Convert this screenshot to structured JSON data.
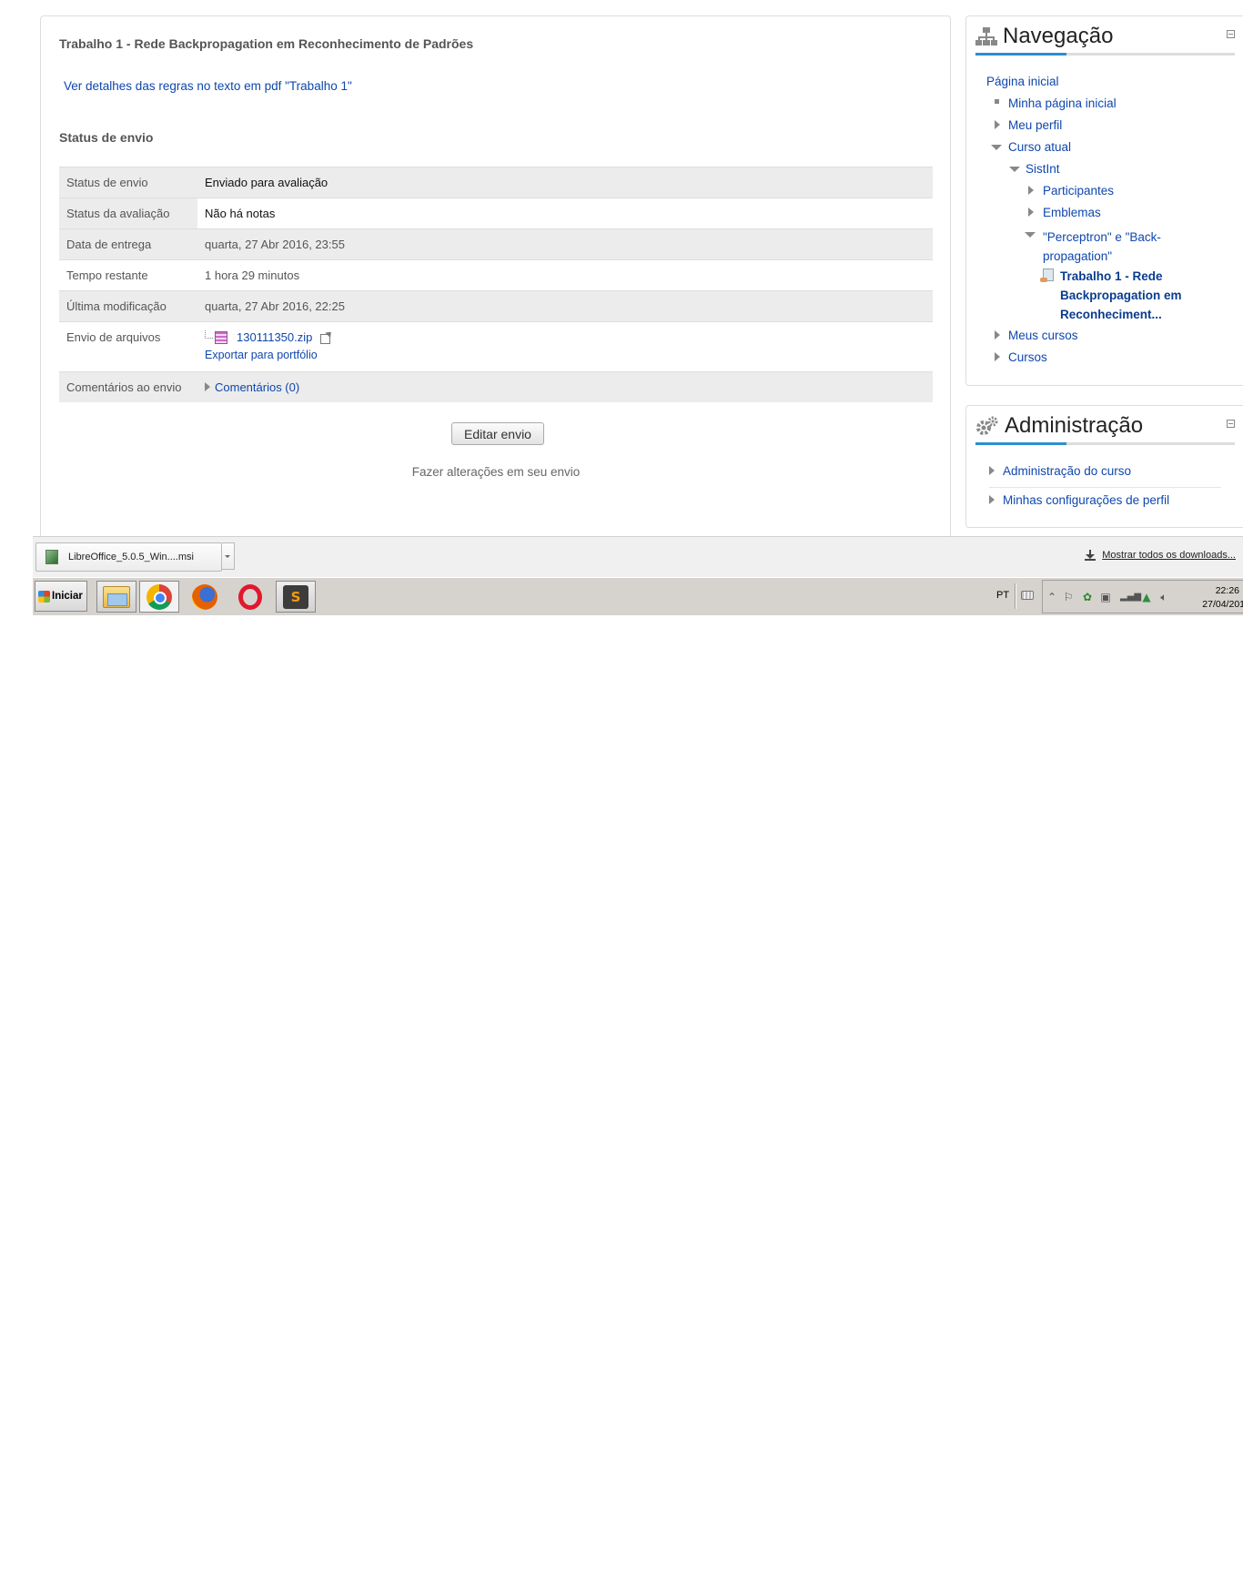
{
  "assignment": {
    "title": "Trabalho 1 - Rede Backpropagation em Reconhecimento de Padrões",
    "rules_link": "Ver detalhes das regras no texto em pdf \"Trabalho 1\"",
    "status_heading": "Status de envio",
    "status_rows": [
      {
        "label": "Status de envio",
        "value": "Enviado para avaliação"
      },
      {
        "label": "Status da avaliação",
        "value": "Não há notas"
      },
      {
        "label": "Data de entrega",
        "value": "quarta, 27 Abr 2016, 23:55"
      },
      {
        "label": "Tempo restante",
        "value": "1 hora 29 minutos"
      },
      {
        "label": "Última modificação",
        "value": "quarta, 27 Abr 2016, 22:25"
      },
      {
        "label": "Envio de arquivos",
        "file_name": "130111350.zip",
        "export_link": "Exportar para portfólio"
      },
      {
        "label": "Comentários ao envio",
        "comments_link": "Comentários (0)"
      }
    ],
    "edit_button": "Editar envio",
    "edit_help": "Fazer alterações em seu envio"
  },
  "navigation": {
    "title": "Navegação",
    "items": [
      {
        "label": "Página inicial"
      },
      {
        "label": "Minha página inicial"
      },
      {
        "label": "Meu perfil"
      },
      {
        "label": "Curso atual"
      },
      {
        "label": "SistInt"
      },
      {
        "label": "Participantes"
      },
      {
        "label": "Emblemas"
      },
      {
        "label": "\"Perceptron\" e \"Back-propagation\""
      },
      {
        "label": "Trabalho 1 - Rede Backpropagation em Reconheciment..."
      },
      {
        "label": "Meus cursos"
      },
      {
        "label": "Cursos"
      }
    ]
  },
  "administration": {
    "title": "Administração",
    "items": [
      {
        "label": "Administração do curso"
      },
      {
        "label": "Minhas configurações de perfil"
      }
    ]
  },
  "download_bar": {
    "file_label": "LibreOffice_5.0.5_Win....msi",
    "show_all": "Mostrar todos os downloads..."
  },
  "taskbar": {
    "start_label": "Iniciar",
    "apps": [
      "folder-icon",
      "chrome-icon",
      "firefox-icon",
      "opera-icon",
      "sublime-text-icon"
    ],
    "language": "PT",
    "time": "22:26",
    "date": "27/04/201"
  },
  "colors": {
    "link": "#0f47ad",
    "accent_underline": "#2b8fd0",
    "row_shade": "#ececec"
  }
}
